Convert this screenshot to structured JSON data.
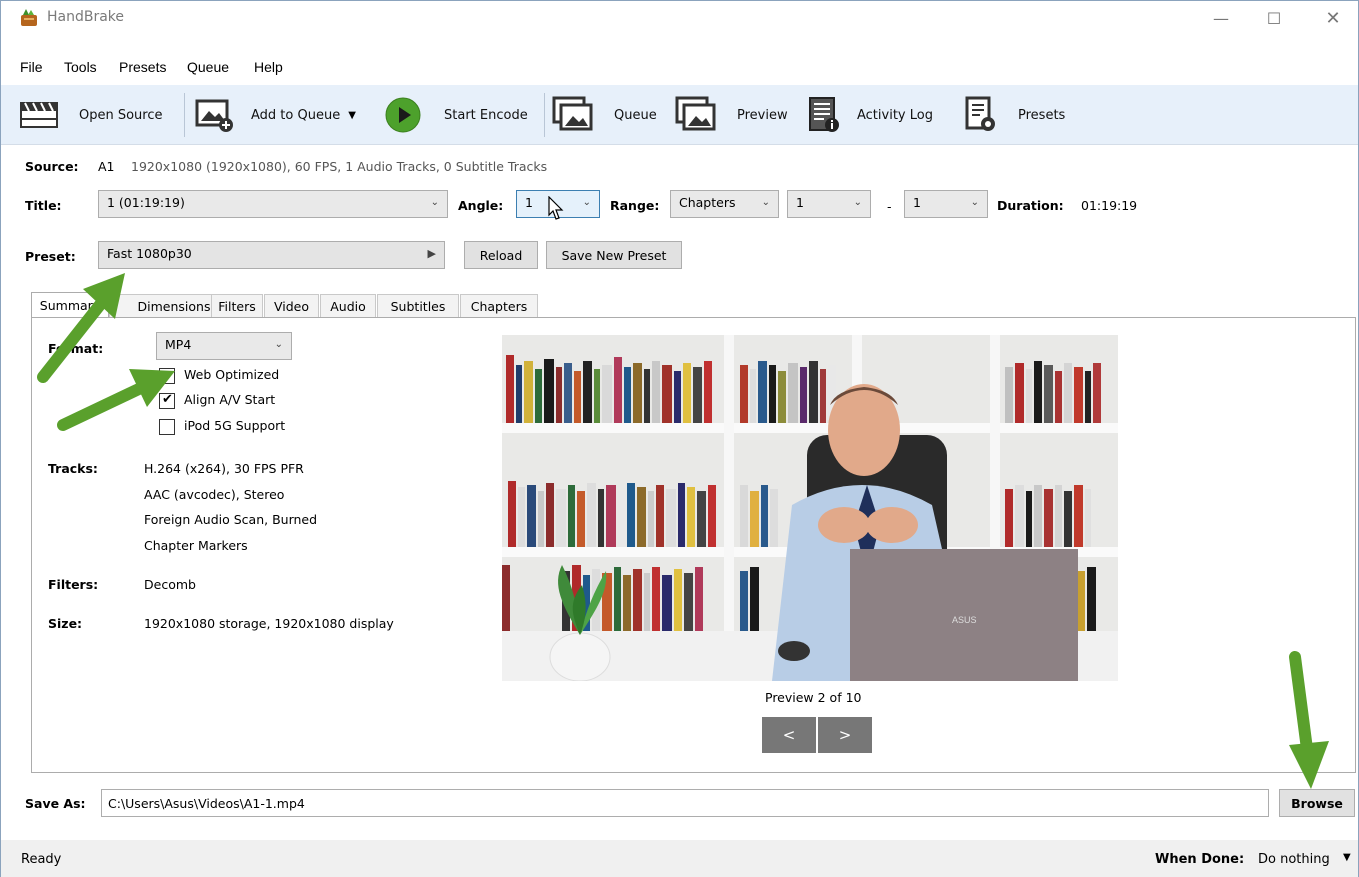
{
  "window": {
    "title": "HandBrake"
  },
  "menu": [
    "File",
    "Tools",
    "Presets",
    "Queue",
    "Help"
  ],
  "toolbar": {
    "open_source": "Open Source",
    "add_to_queue": "Add to Queue",
    "start_encode": "Start Encode",
    "queue": "Queue",
    "preview": "Preview",
    "activity_log": "Activity Log",
    "presets": "Presets"
  },
  "source": {
    "label": "Source:",
    "name": "A1",
    "info": "1920x1080 (1920x1080), 60 FPS, 1 Audio Tracks, 0 Subtitle Tracks"
  },
  "title_row": {
    "title_label": "Title:",
    "title_value": "1 (01:19:19)",
    "angle_label": "Angle:",
    "angle_value": "1",
    "range_label": "Range:",
    "range_type": "Chapters",
    "range_start": "1",
    "range_dash": "-",
    "range_end": "1",
    "duration_label": "Duration:",
    "duration_value": "01:19:19"
  },
  "preset_row": {
    "label": "Preset:",
    "value": "Fast 1080p30",
    "reload": "Reload",
    "save_new": "Save New Preset"
  },
  "tabs": [
    "Summary",
    "Dimensions",
    "Filters",
    "Video",
    "Audio",
    "Subtitles",
    "Chapters"
  ],
  "summary": {
    "format_label": "Format:",
    "format_value": "MP4",
    "web_optimized": "Web Optimized",
    "web_optimized_checked": false,
    "align_av": "Align A/V Start",
    "align_av_checked": true,
    "ipod": "iPod 5G Support",
    "ipod_checked": false,
    "tracks_label": "Tracks:",
    "tracks": [
      "H.264 (x264), 30 FPS PFR",
      "AAC (avcodec), Stereo",
      "Foreign Audio Scan, Burned",
      "Chapter Markers"
    ],
    "filters_label": "Filters:",
    "filters_value": "Decomb",
    "size_label": "Size:",
    "size_value": "1920x1080 storage, 1920x1080 display",
    "preview_caption": "Preview 2 of 10",
    "prev_btn": "<",
    "next_btn": ">"
  },
  "save_as": {
    "label": "Save As:",
    "value": "C:\\Users\\Asus\\Videos\\A1-1.mp4",
    "browse": "Browse"
  },
  "status": {
    "text": "Ready",
    "when_done_label": "When Done:",
    "when_done_value": "Do nothing"
  },
  "colors": {
    "annotation_arrow": "#5aa02c",
    "toolbar_bg": "#e7f0fa"
  }
}
